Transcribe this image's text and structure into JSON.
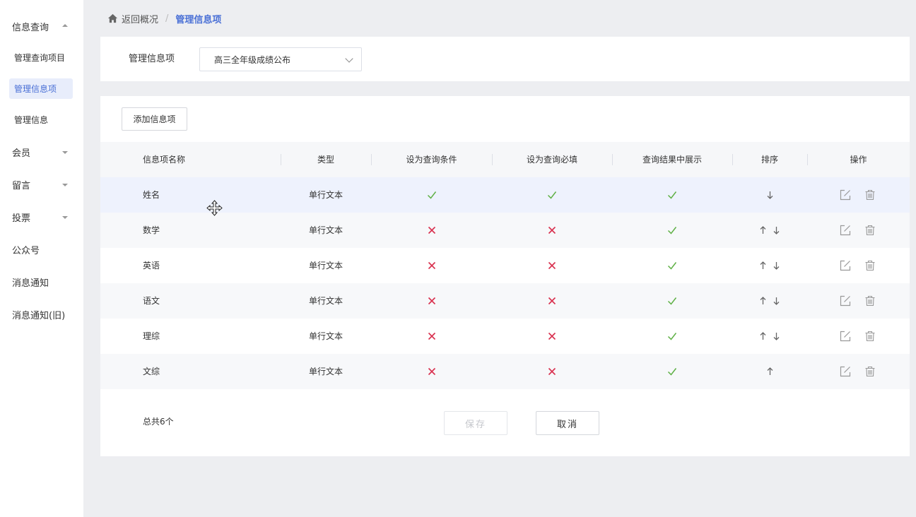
{
  "sidebar": {
    "items": [
      {
        "label": "信息查询",
        "caret": "up"
      },
      {
        "label": "会员",
        "caret": "down"
      },
      {
        "label": "留言",
        "caret": "down"
      },
      {
        "label": "投票",
        "caret": "down"
      },
      {
        "label": "公众号",
        "caret": ""
      },
      {
        "label": "消息通知",
        "caret": ""
      },
      {
        "label": "消息通知(旧)",
        "caret": ""
      }
    ],
    "sub_items": [
      {
        "label": "管理查询项目",
        "active": false
      },
      {
        "label": "管理信息项",
        "active": true
      },
      {
        "label": "管理信息",
        "active": false
      }
    ]
  },
  "breadcrumb": {
    "home_icon": "home-icon",
    "back_label": "返回概况",
    "separator": "/",
    "current": "管理信息项"
  },
  "filter": {
    "label": "管理信息项",
    "selected": "高三全年级成绩公布"
  },
  "table": {
    "add_button": "添加信息项",
    "columns": [
      "信息项名称",
      "类型",
      "设为查询条件",
      "设为查询必填",
      "查询结果中展示",
      "排序",
      "操作"
    ],
    "rows": [
      {
        "name": "姓名",
        "type": "单行文本",
        "query_condition": true,
        "required": true,
        "show_in_result": true,
        "sort": [
          "down"
        ]
      },
      {
        "name": "数学",
        "type": "单行文本",
        "query_condition": false,
        "required": false,
        "show_in_result": true,
        "sort": [
          "up",
          "down"
        ]
      },
      {
        "name": "英语",
        "type": "单行文本",
        "query_condition": false,
        "required": false,
        "show_in_result": true,
        "sort": [
          "up",
          "down"
        ]
      },
      {
        "name": "语文",
        "type": "单行文本",
        "query_condition": false,
        "required": false,
        "show_in_result": true,
        "sort": [
          "up",
          "down"
        ]
      },
      {
        "name": "理综",
        "type": "单行文本",
        "query_condition": false,
        "required": false,
        "show_in_result": true,
        "sort": [
          "up",
          "down"
        ]
      },
      {
        "name": "文综",
        "type": "单行文本",
        "query_condition": false,
        "required": false,
        "show_in_result": true,
        "sort": [
          "up"
        ]
      }
    ],
    "operations": [
      "edit-icon",
      "trash-icon"
    ]
  },
  "footer": {
    "total": "总共6个",
    "save_label": "保存",
    "cancel_label": "取消"
  },
  "colors": {
    "accent": "#4a70d6",
    "check": "#5fb045",
    "cross": "#d9304e"
  }
}
